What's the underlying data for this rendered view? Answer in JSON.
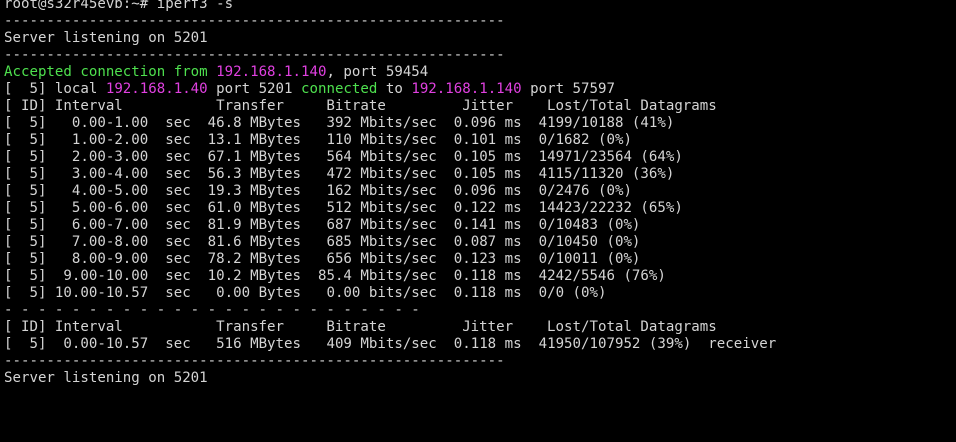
{
  "window": {
    "title": "root@s32r45evb:~# iperf3 -s"
  },
  "colors": {
    "background": "#000000",
    "text": "#d4d4d4",
    "green": "#4ee04e",
    "magenta": "#e040e0"
  },
  "lines": [
    {
      "type": "text",
      "text": "root@s32r45evb:~# iperf3 -s"
    },
    {
      "type": "text",
      "text": "-----------------------------------------------------------"
    },
    {
      "type": "text",
      "text": "Server listening on 5201"
    },
    {
      "type": "text",
      "text": "-----------------------------------------------------------"
    },
    {
      "type": "segments",
      "segments": [
        {
          "text": "Accepted connection from ",
          "color": "green"
        },
        {
          "text": "192.168.1.140",
          "color": "magenta"
        },
        {
          "text": ", port 59454",
          "color": ""
        }
      ]
    },
    {
      "type": "segments",
      "segments": [
        {
          "text": "[  5] local ",
          "color": ""
        },
        {
          "text": "192.168.1.40",
          "color": "magenta"
        },
        {
          "text": " port 5201 ",
          "color": ""
        },
        {
          "text": "connected",
          "color": "green"
        },
        {
          "text": " to ",
          "color": ""
        },
        {
          "text": "192.168.1.140",
          "color": "magenta"
        },
        {
          "text": " port 57597",
          "color": ""
        }
      ]
    },
    {
      "type": "header",
      "text": "[ ID] Interval           Transfer     Bitrate         Jitter    Lost/Total Datagrams"
    },
    {
      "type": "row",
      "id": "  5",
      "interval": "0.00-1.00",
      "transfer": "46.8 MBytes",
      "bitrate": "392 Mbits/sec",
      "jitter": "0.096 ms",
      "lost_total": "4199/10188 (41%)"
    },
    {
      "type": "row",
      "id": "  5",
      "interval": "1.00-2.00",
      "transfer": "13.1 MBytes",
      "bitrate": "110 Mbits/sec",
      "jitter": "0.101 ms",
      "lost_total": "0/1682 (0%)"
    },
    {
      "type": "row",
      "id": "  5",
      "interval": "2.00-3.00",
      "transfer": "67.1 MBytes",
      "bitrate": "564 Mbits/sec",
      "jitter": "0.105 ms",
      "lost_total": "14971/23564 (64%)"
    },
    {
      "type": "row",
      "id": "  5",
      "interval": "3.00-4.00",
      "transfer": "56.3 MBytes",
      "bitrate": "472 Mbits/sec",
      "jitter": "0.105 ms",
      "lost_total": "4115/11320 (36%)"
    },
    {
      "type": "row",
      "id": "  5",
      "interval": "4.00-5.00",
      "transfer": "19.3 MBytes",
      "bitrate": "162 Mbits/sec",
      "jitter": "0.096 ms",
      "lost_total": "0/2476 (0%)"
    },
    {
      "type": "row",
      "id": "  5",
      "interval": "5.00-6.00",
      "transfer": "61.0 MBytes",
      "bitrate": "512 Mbits/sec",
      "jitter": "0.122 ms",
      "lost_total": "14423/22232 (65%)"
    },
    {
      "type": "row",
      "id": "  5",
      "interval": "6.00-7.00",
      "transfer": "81.9 MBytes",
      "bitrate": "687 Mbits/sec",
      "jitter": "0.141 ms",
      "lost_total": "0/10483 (0%)"
    },
    {
      "type": "row",
      "id": "  5",
      "interval": "7.00-8.00",
      "transfer": "81.6 MBytes",
      "bitrate": "685 Mbits/sec",
      "jitter": "0.087 ms",
      "lost_total": "0/10450 (0%)"
    },
    {
      "type": "row",
      "id": "  5",
      "interval": "8.00-9.00",
      "transfer": "78.2 MBytes",
      "bitrate": "656 Mbits/sec",
      "jitter": "0.123 ms",
      "lost_total": "0/10011 (0%)"
    },
    {
      "type": "row",
      "id": "  5",
      "interval": "9.00-10.00",
      "transfer": "10.2 MBytes",
      "bitrate": "85.4 Mbits/sec",
      "jitter": "0.118 ms",
      "lost_total": "4242/5546 (76%)"
    },
    {
      "type": "row",
      "id": "  5",
      "interval": "10.00-10.57",
      "transfer": "0.00 Bytes",
      "bitrate": "0.00 bits/sec",
      "jitter": "0.118 ms",
      "lost_total": "0/0 (0%)"
    },
    {
      "type": "text",
      "text": "- - - - - - - - - - - - - - - - - - - - - - - - -"
    },
    {
      "type": "header",
      "text": "[ ID] Interval           Transfer     Bitrate         Jitter    Lost/Total Datagrams"
    },
    {
      "type": "summary",
      "id": "  5",
      "interval": "0.00-10.57",
      "transfer": "516 MBytes",
      "bitrate": "409 Mbits/sec",
      "jitter": "0.118 ms",
      "lost_total": "41950/107952 (39%)",
      "role": "receiver"
    },
    {
      "type": "text",
      "text": "-----------------------------------------------------------"
    },
    {
      "type": "text",
      "text": "Server listening on 5201"
    }
  ]
}
